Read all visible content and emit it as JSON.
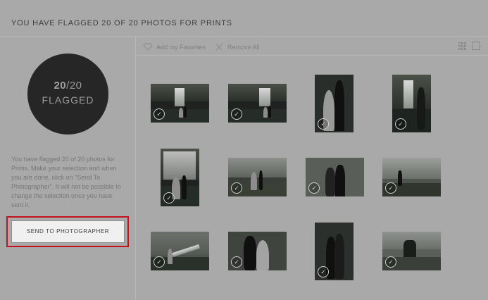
{
  "header": {
    "title": "YOU HAVE FLAGGED 20 OF 20 PHOTOS FOR PRINTS"
  },
  "sidebar": {
    "flag_count": "20",
    "flag_total": "/20",
    "flag_label": "FLAGGED",
    "description": "You have flagged 20 of 20 photos for Prints. Make your selection and when you are done, click on \"Send To Photographer\". It will not be possible to change the selection once you have sent it.",
    "send_button": "SEND TO PHOTOGRAPHER"
  },
  "toolbar": {
    "favorites_label": "Add my Favorites",
    "remove_label": "Remove All"
  },
  "icons": {
    "favorites": "heart-icon",
    "remove": "close-icon",
    "grid_view": "grid-view-icon",
    "single_view": "single-view-icon",
    "check": "check-circle-icon"
  },
  "colors": {
    "highlight": "#c6121c",
    "circle": "#262626"
  },
  "photos": [
    {
      "check": "✓"
    },
    {
      "check": "✓"
    },
    {
      "check": "✓"
    },
    {
      "check": "✓"
    },
    {
      "check": "✓"
    },
    {
      "check": "✓"
    },
    {
      "check": "✓"
    },
    {
      "check": "✓"
    },
    {
      "check": "✓"
    },
    {
      "check": "✓"
    },
    {
      "check": "✓"
    },
    {
      "check": "✓"
    }
  ]
}
